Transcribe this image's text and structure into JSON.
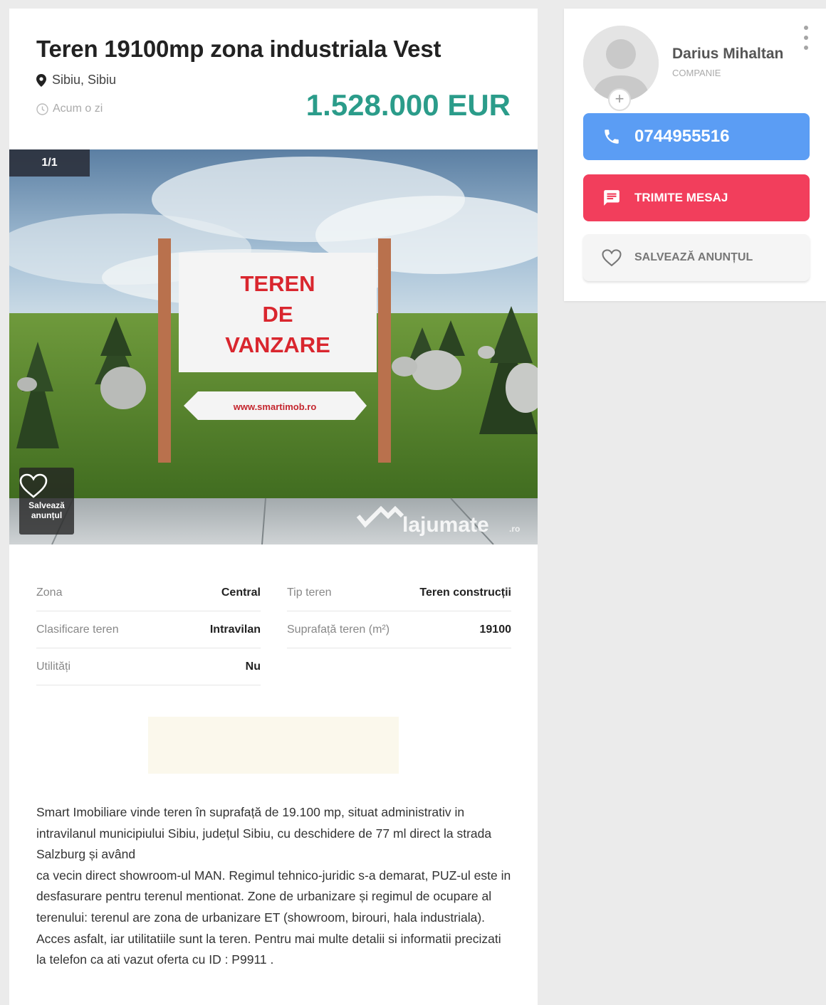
{
  "listing": {
    "title": "Teren 19100mp zona industriala Vest",
    "location": "Sibiu, Sibiu",
    "posted": "Acum o zi",
    "price": "1.528.000 EUR"
  },
  "gallery": {
    "counter": "1/1",
    "save_overlay_label": "Salvează anunțul",
    "image": {
      "sign_lines": [
        "TEREN",
        "DE",
        "VANZARE"
      ],
      "sign_url": "www.smartimob.ro",
      "watermark": "lajumate",
      "watermark_tld": ".ro"
    }
  },
  "specs": [
    {
      "label": "Zona",
      "value": "Central"
    },
    {
      "label": "Tip teren",
      "value": "Teren construcții"
    },
    {
      "label": "Clasificare teren",
      "value": "Intravilan"
    },
    {
      "label": "Suprafață teren (m²)",
      "value": "19100"
    },
    {
      "label": "Utilități",
      "value": "Nu"
    }
  ],
  "description": "Smart Imobiliare vinde teren în suprafață de 19.100 mp, situat administrativ in intravilanul municipiului Sibiu, județul Sibiu, cu deschidere de 77 ml direct la strada Salzburg și având\nca vecin direct showroom-ul MAN. Regimul tehnico-juridic s-a demarat, PUZ-ul este in desfasurare pentru terenul mentionat. Zone de urbanizare și regimul de ocupare al terenului: terenul are zona de urbanizare ET (showroom, birouri, hala industriala). Acces asfalt, iar utilitatiile sunt la teren. Pentru mai multe detalii si informatii precizati la telefon ca ati vazut oferta cu ID : P9911 .",
  "seller": {
    "name": "Darius Mihaltan",
    "type": "COMPANIE",
    "avatar_plus": "+"
  },
  "actions": {
    "phone": "0744955516",
    "message": "TRIMITE MESAJ",
    "save": "SALVEAZĂ ANUNȚUL"
  },
  "colors": {
    "price": "#2b9c8a",
    "phone_button": "#5b9df4",
    "message_button": "#f23e5c",
    "page_background": "#ebebeb"
  },
  "icons": [
    "map-pin-icon",
    "clock-icon",
    "heart-icon",
    "phone-icon",
    "message-icon",
    "more-vert-icon",
    "avatar-placeholder-icon",
    "add-photo-icon"
  ]
}
